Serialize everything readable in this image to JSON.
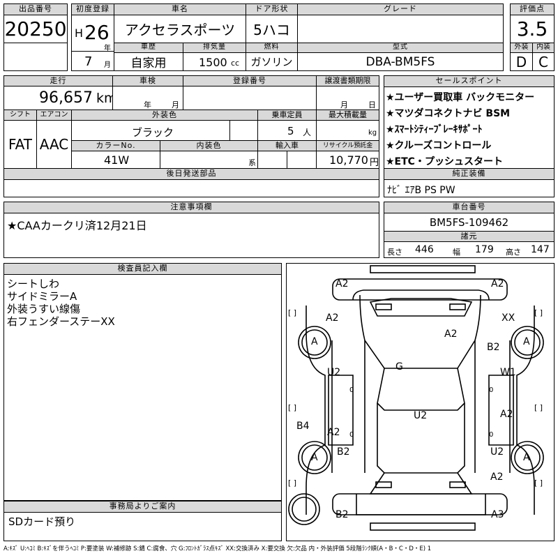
{
  "top": {
    "lot_label": "出品番号",
    "lot_value": "20250",
    "first_reg_label": "初度登録",
    "era": "H",
    "year": "26",
    "year_unit": "年",
    "month": "7",
    "month_unit": "月",
    "name_label": "車名",
    "name_value": "アクセラスポーツ",
    "door_label": "ドア形状",
    "door_value": "5ハコ",
    "grade_label": "グレード",
    "grade_value": "",
    "score_label": "評価点",
    "score_value": "3.5",
    "history_label": "車歴",
    "history_value": "自家用",
    "displacement_label": "排気量",
    "displacement_value": "1500",
    "displacement_unit": "cc",
    "fuel_label": "燃料",
    "fuel_value": "ガソリン",
    "model_label": "型式",
    "model_value": "DBA-BM5FS",
    "exterior_label": "外装",
    "exterior_value": "D",
    "interior_label": "内装",
    "interior_value": "C"
  },
  "mid": {
    "mileage_label": "走行",
    "mileage_value": "96,657",
    "mileage_unit": "km",
    "inspection_label": "車検",
    "inspection_year": "年",
    "inspection_month": "月",
    "plate_label": "登録番号",
    "transfer_label": "譲渡書類期限",
    "transfer_month": "月",
    "transfer_day": "日",
    "shift_label": "シフト",
    "shift_value": "FAT",
    "ac_label": "エアコン",
    "ac_value": "AAC",
    "color_label": "外装色",
    "color_value": "ブラック",
    "capacity_label": "乗車定員",
    "capacity_value": "5",
    "capacity_unit": "人",
    "load_label": "最大積載量",
    "load_unit": "kg",
    "colorno_label": "カラーNo.",
    "colorno_value": "41W",
    "intcolor_label": "内装色",
    "intcolor_unit": "系",
    "import_label": "輸入車",
    "recycle_label": "リサイクル預託金",
    "recycle_value": "10,770",
    "recycle_unit": "円",
    "later_label": "後日発送部品"
  },
  "sales": {
    "label": "セールスポイント",
    "items": [
      "★ユーザー買取車 バックモニター",
      "★マツダコネクトナビ BSM",
      "★ｽﾏｰﾄｼﾃｨｰﾌﾞﾚｰｷｻﾎﾟｰﾄ",
      "★クルーズコントロール",
      "★ETC・プッシュスタート"
    ]
  },
  "equip": {
    "label": "純正装備",
    "value": "ﾅﾋﾞ ｴｱB PS PW"
  },
  "notes": {
    "label": "注意事項欄",
    "value": "★CAAカークリ済12月21日"
  },
  "chassis": {
    "label": "車台番号",
    "value": "BM5FS-109462"
  },
  "dims": {
    "label": "諸元",
    "len_label": "長さ",
    "len": "446",
    "wid_label": "幅",
    "wid": "179",
    "hei_label": "高さ",
    "hei": "147"
  },
  "inspector": {
    "label": "検査員記入欄",
    "lines": [
      "シートしわ",
      "サイドミラーA",
      "外装うすい線傷",
      "右フェンダーステーXX"
    ]
  },
  "office": {
    "label": "事務局よりご案内",
    "value": "SDカード預り"
  },
  "diagram": {
    "marks": {
      "front_left": "A2",
      "front_right": "A2",
      "fender_fl": "A2",
      "fender_fr": "XX",
      "hood": "A2",
      "roof": "G",
      "wheel_fl": "A",
      "wheel_fr": "A",
      "door_fl": "U2",
      "door_fr": "W1",
      "b2_fr": "B2",
      "door_rl": "A2",
      "door_rr": "A2",
      "b4": "B4",
      "trunk": "U2",
      "b2_rl": "B2",
      "u2_rr": "U2",
      "wheel_rl": "A",
      "wheel_rr": "A",
      "a2_rr": "A2",
      "rear_left": "B2",
      "rear_right": "A3"
    },
    "brackets": "[ ]"
  },
  "legend": "A:ｷｽﾞ U:ﾍｺﾐ B:ｷｽﾞを伴うﾍｺﾐ P:要塗装 W:補修跡 S:錆 C:腐食、穴 G:ﾌﾛﾝﾄｶﾞﾗｽ点ｷｽﾞ XX:交換済み X:要交換 欠:欠品 内・外装評価 5段階ﾗﾝｸ順(A・B・C・D・E) 1"
}
